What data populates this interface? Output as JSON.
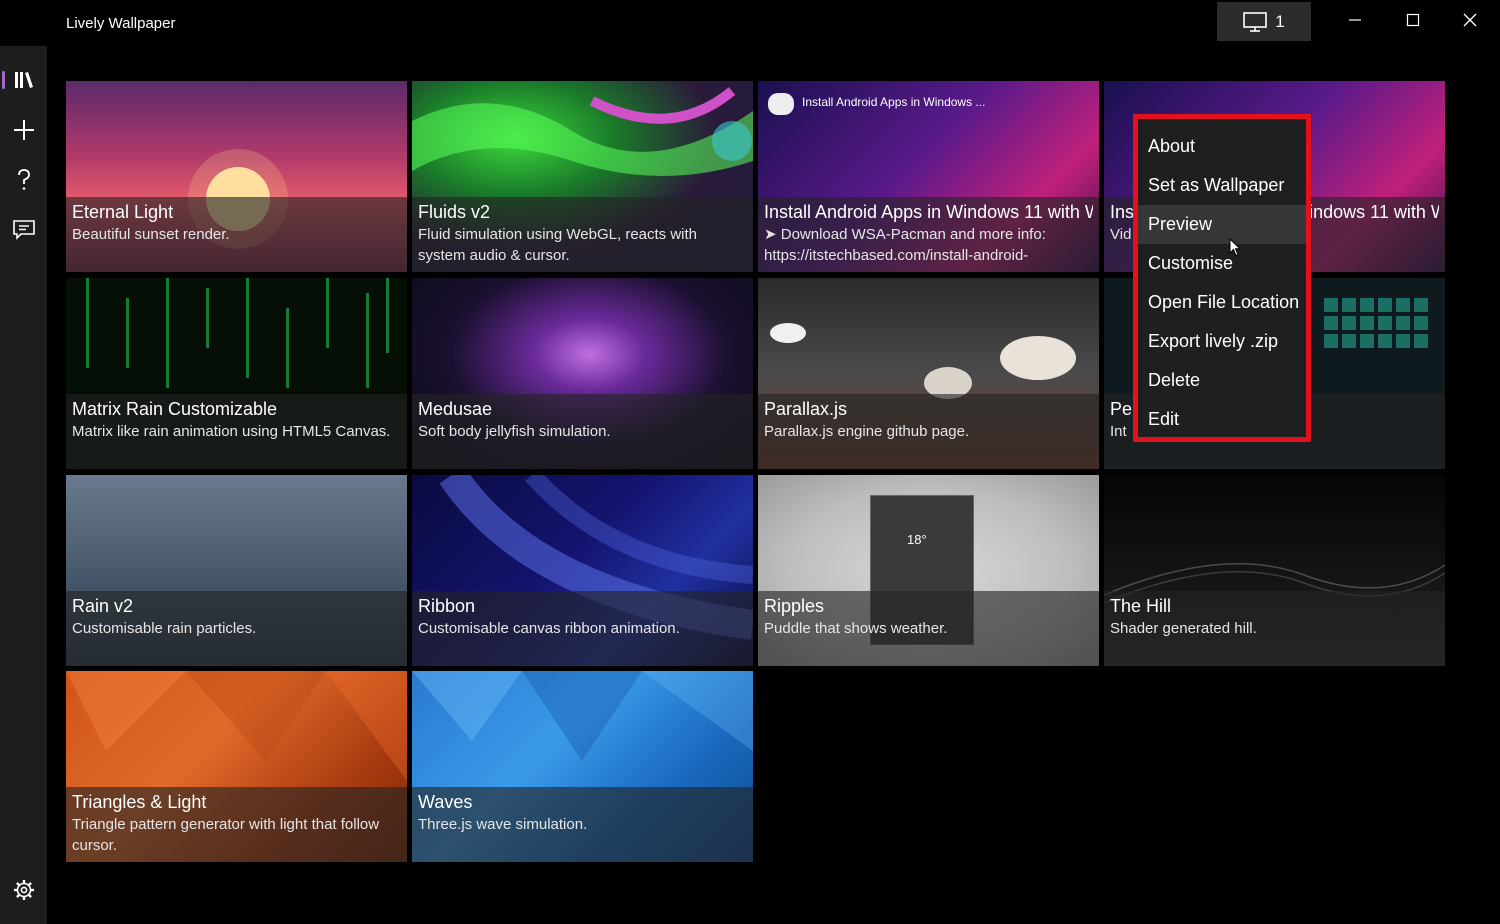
{
  "window": {
    "title": "Lively Wallpaper",
    "monitor_label": "1"
  },
  "sidebar": {
    "items": [
      {
        "name": "library",
        "icon": "library-icon",
        "active": true
      },
      {
        "name": "add",
        "icon": "plus-icon"
      },
      {
        "name": "help",
        "icon": "help-icon"
      },
      {
        "name": "feedback",
        "icon": "feedback-icon"
      }
    ],
    "settings_icon": "gear-icon"
  },
  "library": [
    {
      "title": "Eternal Light",
      "description": "Beautiful sunset render."
    },
    {
      "title": "Fluids v2",
      "description": "Fluid simulation using WebGL, reacts with system audio & cursor."
    },
    {
      "title": "Install Android Apps in Windows 11 with W",
      "description": "➤ Download WSA-Pacman and more info: https://itstechbased.com/install-android-",
      "thumb_text": "Install Android Apps in Windows ..."
    },
    {
      "title": "Install Android Apps in Windows 11 with W",
      "description": "Vid"
    },
    {
      "title": "Matrix Rain Customizable",
      "description": "Matrix like rain animation using HTML5 Canvas."
    },
    {
      "title": "Medusae",
      "description": "Soft body jellyfish simulation."
    },
    {
      "title": "Parallax.js",
      "description": "Parallax.js engine github page."
    },
    {
      "title": "Pe",
      "description": "Int                         elements."
    },
    {
      "title": "Rain v2",
      "description": "Customisable rain particles."
    },
    {
      "title": "Ribbon",
      "description": "Customisable canvas ribbon animation.",
      "selected": true
    },
    {
      "title": "Ripples",
      "description": "Puddle that shows weather.",
      "thumb_text": "18°"
    },
    {
      "title": "The Hill",
      "description": "Shader generated hill."
    },
    {
      "title": "Triangles & Light",
      "description": "Triangle pattern generator with light that follow cursor."
    },
    {
      "title": "Waves",
      "description": "Three.js wave simulation."
    }
  ],
  "context_menu": {
    "items": [
      "About",
      "Set as Wallpaper",
      "Preview",
      "Customise",
      "Open File Location",
      "Export lively .zip",
      "Delete",
      "Edit"
    ],
    "hovered": "Preview",
    "highlight_color": "#e3111b"
  },
  "colors": {
    "accent": "#9b4fc0",
    "background": "#000000",
    "sidebar": "#1d1d1d"
  }
}
